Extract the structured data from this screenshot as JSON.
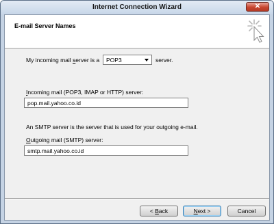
{
  "window": {
    "title": "Internet Connection Wizard",
    "close_glyph": "✕"
  },
  "header": {
    "title": "E-mail Server Names"
  },
  "form": {
    "incoming_type_label_pre": "My incoming mail ",
    "incoming_type_label_ul": "s",
    "incoming_type_label_post": "erver is a",
    "incoming_type_value": "POP3",
    "incoming_type_suffix": "server.",
    "incoming_label_ul": "I",
    "incoming_label_rest": "ncoming mail (POP3, IMAP or HTTP) server:",
    "incoming_value": "pop.mail.yahoo.co.id",
    "smtp_info": "An SMTP server is the server that is used for your outgoing e-mail.",
    "outgoing_label_ul": "O",
    "outgoing_label_rest": "utgoing mail (SMTP) server:",
    "outgoing_value": "smtp.mail.yahoo.co.id"
  },
  "buttons": {
    "back_pre": "< ",
    "back_ul": "B",
    "back_post": "ack",
    "next_ul": "N",
    "next_post": "ext >",
    "cancel": "Cancel"
  },
  "icons": {
    "close": "close-icon",
    "wizard": "wizard-cursor-icon",
    "dropdown": "chevron-down-icon"
  }
}
